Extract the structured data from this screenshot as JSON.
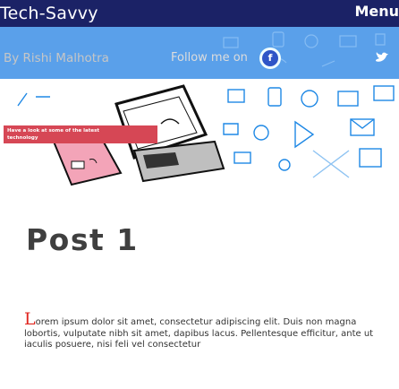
{
  "site": {
    "title": "Tech-Savvy",
    "menu_label": "Menu"
  },
  "byline": {
    "author": "By Rishi Malhotra",
    "follow_label": "Follow me on",
    "facebook_glyph": "f",
    "twitter_icon": "twitter-icon"
  },
  "hero": {
    "caption_line1": "Have a look at some of the latest",
    "caption_line2": "technology"
  },
  "post": {
    "title": "Post 1",
    "dropcap": "L",
    "body": "orem ipsum dolor sit amet, consectetur adipiscing elit. Duis non magna lobortis, vulputate nibh sit amet, dapibus lacus. Pellentesque efficitur, ante ut iaculis posuere, nisi feli vel consectetur"
  },
  "colors": {
    "header_bg": "#1b2266",
    "byline_bg": "#5aa0ea",
    "accent_red": "#e0261f",
    "icon_blue": "#1e88e5"
  }
}
